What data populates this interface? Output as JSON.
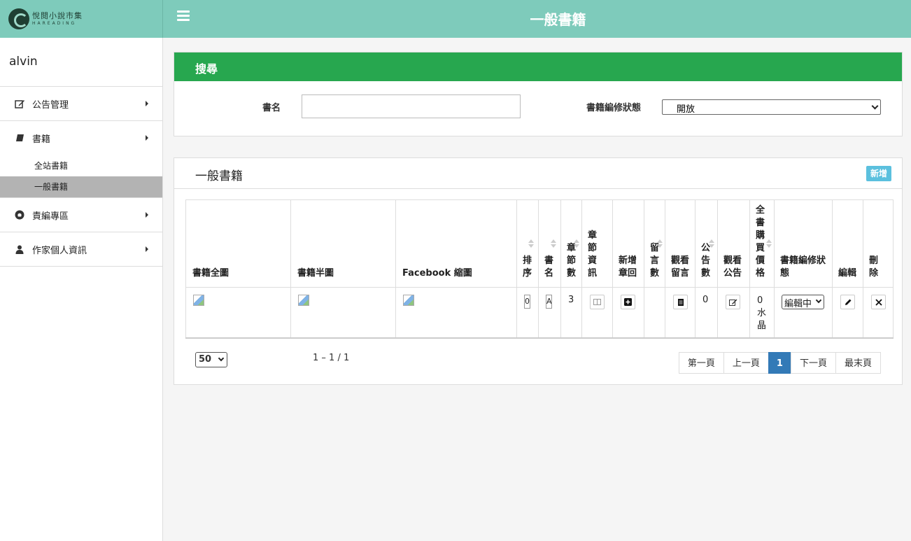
{
  "brand": {
    "name_zh": "悅閱小說市集",
    "name_en": "HAREADING"
  },
  "header": {
    "title": "一般書籍"
  },
  "sidebar": {
    "username": "alvin",
    "items": [
      {
        "label": "公告管理",
        "icon": "edit-icon"
      },
      {
        "label": "書籍",
        "icon": "book-icon"
      },
      {
        "label": "責編專區",
        "icon": "github-icon"
      },
      {
        "label": "作家個人資訊",
        "icon": "user-icon"
      }
    ],
    "book_sub": [
      {
        "label": "全站書籍"
      },
      {
        "label": "一般書籍"
      }
    ]
  },
  "search": {
    "title": "搜尋",
    "name_label": "書名",
    "name_value": "",
    "status_label": "書籍編修狀態",
    "status_value": "開放"
  },
  "list": {
    "title": "一般書籍",
    "add_label": "新增",
    "columns": {
      "full_image": "書籍全圖",
      "half_image": "書籍半圖",
      "fb_thumb": "Facebook 縮圖",
      "order": "排序",
      "book_name": "書名",
      "chapters": "章節數",
      "chapter_info": "章節資訊",
      "add_chapter": "新增章回",
      "comments": "留言數",
      "view_comments": "觀看留言",
      "announcements": "公告數",
      "view_announcements": "觀看公告",
      "full_price": "全書購買價格",
      "edit_status": "書籍編修狀態",
      "edit": "編輯",
      "delete": "刪除"
    },
    "rows": [
      {
        "order_value": "0",
        "name_value": "A",
        "chapters": "3",
        "comments": "",
        "announcements": "0",
        "price_value": "0",
        "price_unit": "水晶",
        "status_value": "編輯中"
      }
    ]
  },
  "pagination": {
    "page_size": "50",
    "range": "1 – 1 / 1",
    "first": "第一頁",
    "prev": "上一頁",
    "current": "1",
    "next": "下一頁",
    "last": "最末頁"
  }
}
